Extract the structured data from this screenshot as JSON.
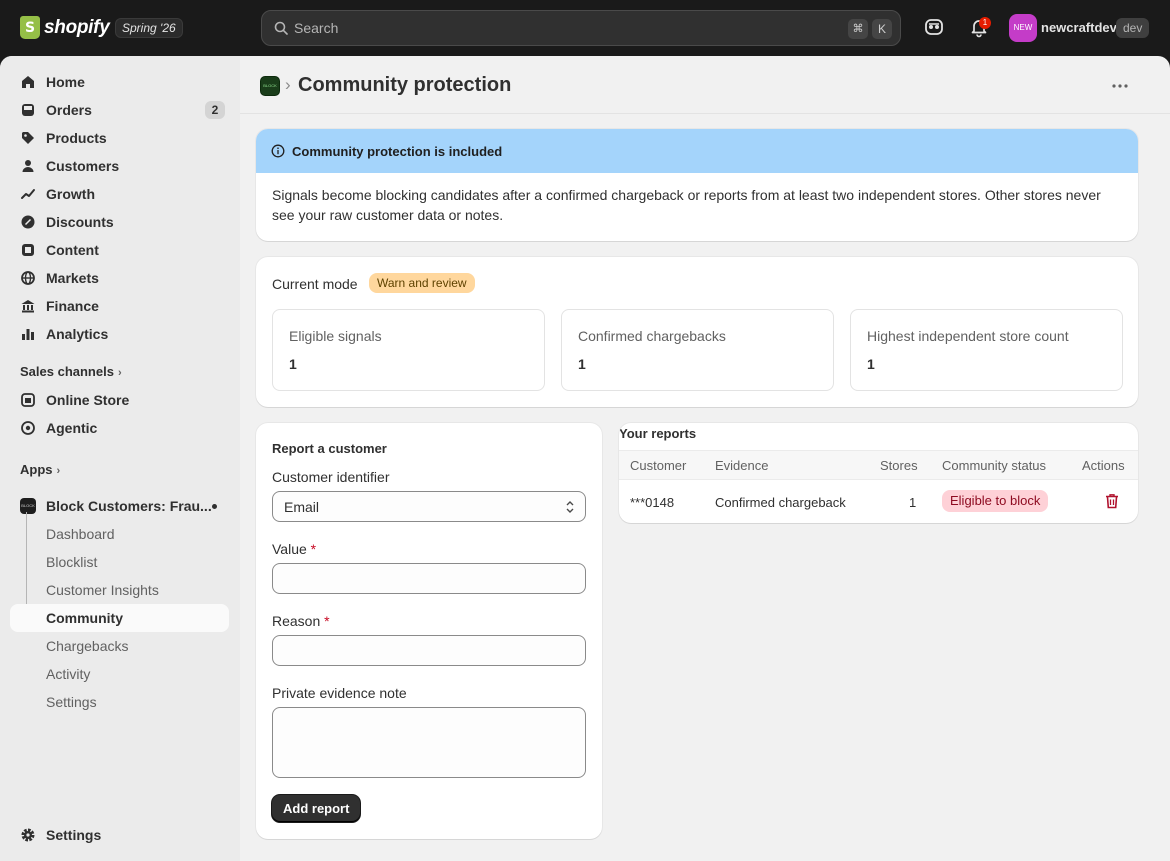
{
  "topbar": {
    "logo_text": "shopify",
    "edition": "Spring '26",
    "search_placeholder": "Search",
    "shortcut_key1": "⌘",
    "shortcut_key2": "K",
    "notification_count": "1",
    "avatar_text": "NEW",
    "shop_name": "newcraftdev",
    "shop_tag": "dev"
  },
  "sidebar": {
    "items": [
      {
        "label": "Home",
        "icon": "home-icon"
      },
      {
        "label": "Orders",
        "icon": "orders-icon",
        "count": "2"
      },
      {
        "label": "Products",
        "icon": "tag-icon"
      },
      {
        "label": "Customers",
        "icon": "person-icon"
      },
      {
        "label": "Growth",
        "icon": "growth-icon"
      },
      {
        "label": "Discounts",
        "icon": "discount-icon"
      },
      {
        "label": "Content",
        "icon": "content-icon"
      },
      {
        "label": "Markets",
        "icon": "globe-icon"
      },
      {
        "label": "Finance",
        "icon": "bank-icon"
      },
      {
        "label": "Analytics",
        "icon": "chart-icon"
      }
    ],
    "sales_channels_title": "Sales channels",
    "channels": [
      {
        "label": "Online Store",
        "icon": "store-icon"
      },
      {
        "label": "Agentic",
        "icon": "agentic-icon"
      }
    ],
    "apps_title": "Apps",
    "app_name": "Block Customers: Frau...",
    "app_thumb_text": "BLOCK",
    "app_subitems": [
      "Dashboard",
      "Blocklist",
      "Customer Insights",
      "Community",
      "Chargebacks",
      "Activity",
      "Settings"
    ],
    "settings_label": "Settings"
  },
  "page": {
    "breadcrumb_app_text": "BLOCK",
    "title": "Community protection"
  },
  "banner": {
    "title": "Community protection is included",
    "body": "Signals become blocking candidates after a confirmed chargeback or reports from at least two independent stores. Other stores never see your raw customer data or notes."
  },
  "mode": {
    "label": "Current mode",
    "value": "Warn and review",
    "stats": [
      {
        "label": "Eligible signals",
        "value": "1"
      },
      {
        "label": "Confirmed chargebacks",
        "value": "1"
      },
      {
        "label": "Highest independent store count",
        "value": "1"
      }
    ]
  },
  "report_form": {
    "title": "Report a customer",
    "identifier_label": "Customer identifier",
    "identifier_value": "Email",
    "value_label": "Value",
    "reason_label": "Reason",
    "note_label": "Private evidence note",
    "required_mark": "*",
    "submit_label": "Add report"
  },
  "reports": {
    "title": "Your reports",
    "columns": [
      "Customer",
      "Evidence",
      "Stores",
      "Community status",
      "Actions"
    ],
    "rows": [
      {
        "customer": "***0148",
        "evidence": "Confirmed chargeback",
        "stores": "1",
        "status": "Eligible to block"
      }
    ]
  },
  "colors": {
    "banner_bg": "#a4d4fb",
    "mode_badge_bg": "#ffd79d",
    "status_badge_bg": "#fed1d7",
    "danger": "#c70a24",
    "brand_green": "#95bf47"
  }
}
